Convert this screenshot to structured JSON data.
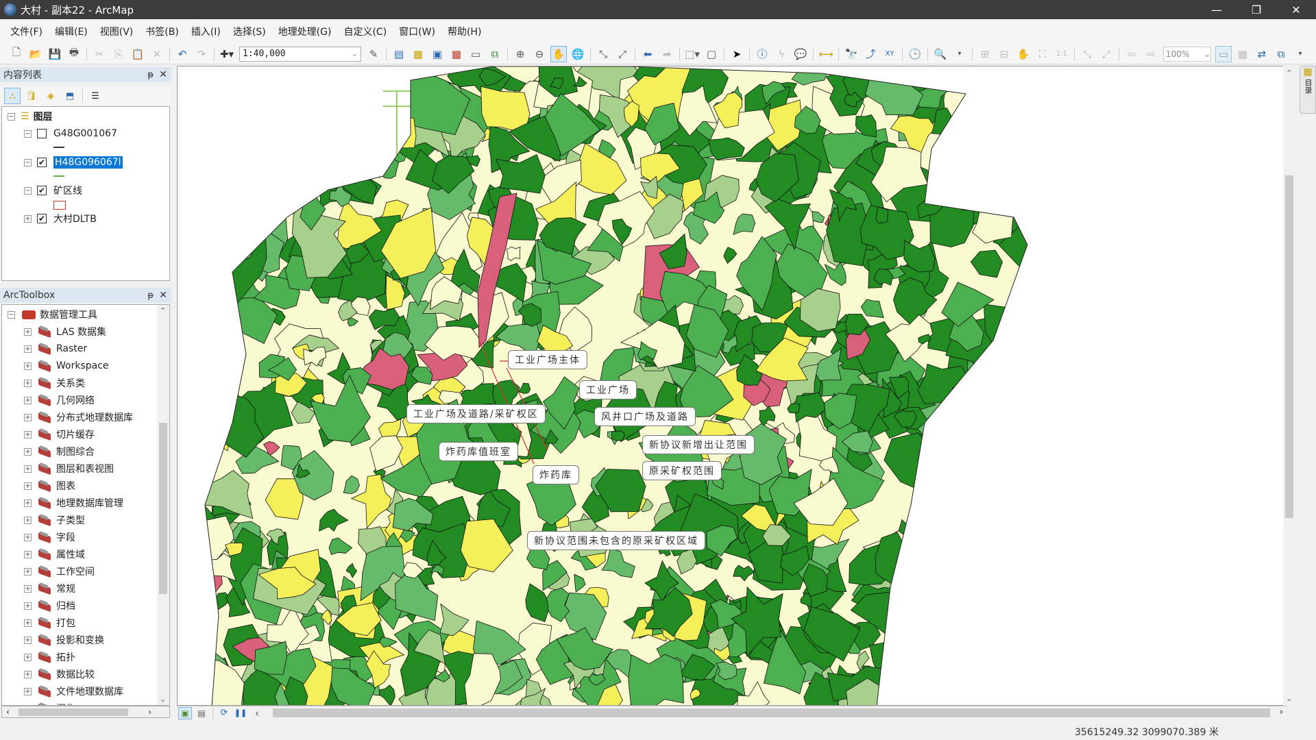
{
  "window": {
    "title": "大村 - 副本22 - ArcMap",
    "minimize": "—",
    "restore": "❐",
    "close": "✕"
  },
  "menu": [
    "文件(F)",
    "编辑(E)",
    "视图(V)",
    "书签(B)",
    "插入(I)",
    "选择(S)",
    "地理处理(G)",
    "自定义(C)",
    "窗口(W)",
    "帮助(H)"
  ],
  "toolbar": {
    "scale_value": "1:40,000",
    "layout_zoom": "100%",
    "icons": [
      "new-document",
      "open-folder",
      "save",
      "print",
      "cut",
      "copy",
      "paste",
      "delete",
      "undo",
      "redo",
      "add-data",
      "scale-dropdown",
      "editor",
      "table",
      "catalog",
      "search",
      "arctoolbox",
      "python",
      "modelbuilder",
      "zoom-in",
      "zoom-out",
      "pan",
      "full-extent",
      "fixed-zoom-in",
      "fixed-zoom-out",
      "back",
      "forward",
      "select-features",
      "clear-selection",
      "select-elements",
      "identify",
      "hyperlink",
      "html-popup",
      "measure",
      "find",
      "route",
      "go-to-xy",
      "time-slider",
      "create-viewer"
    ]
  },
  "toc": {
    "title": "内容列表",
    "pin": "ᵽ",
    "close": "✕",
    "root": "图层",
    "layers": [
      {
        "name": "G48G001067",
        "checked": false,
        "expanded": true,
        "symbol_color": "#333333"
      },
      {
        "name": "H48G096067l",
        "checked": true,
        "expanded": true,
        "selected": true,
        "symbol_color": "#6ab04c"
      },
      {
        "name": "矿区线",
        "checked": true,
        "expanded": true,
        "symbol_color": "#c0392b"
      },
      {
        "name": "大村DLTB",
        "checked": true,
        "expanded": false
      }
    ]
  },
  "arctoolbox": {
    "title": "ArcToolbox",
    "root": "数据管理工具",
    "items": [
      "LAS 数据集",
      "Raster",
      "Workspace",
      "关系类",
      "几何网络",
      "分布式地理数据库",
      "切片缓存",
      "制图综合",
      "图层和表视图",
      "图表",
      "地理数据库管理",
      "子类型",
      "字段",
      "属性域",
      "工作空间",
      "常规",
      "归档",
      "打包",
      "投影和变换",
      "拓扑",
      "数据比较",
      "文件地理数据库",
      "概化"
    ]
  },
  "map": {
    "labels": [
      "工业广场主体",
      "工业广场",
      "工业广场及道路/采矿权区",
      "风井口广场及道路",
      "新协议新增出让范围",
      "炸药库值班室",
      "原采矿权范围",
      "炸药库",
      "新协议范围未包含的原采矿权区域"
    ],
    "colors": {
      "dark_green": "#228b22",
      "mid_green": "#4caf50",
      "light_green": "#66bb6a",
      "pale_green": "#a8d08d",
      "yellow": "#f5f05a",
      "cream": "#fafad0",
      "pink": "#d9607a",
      "grid_line": "#7cbd3a",
      "boundary": "#d03030"
    }
  },
  "status": {
    "coordinates": "35615249.32  3099070.389 米"
  },
  "right_dock": {
    "label": "目录"
  }
}
